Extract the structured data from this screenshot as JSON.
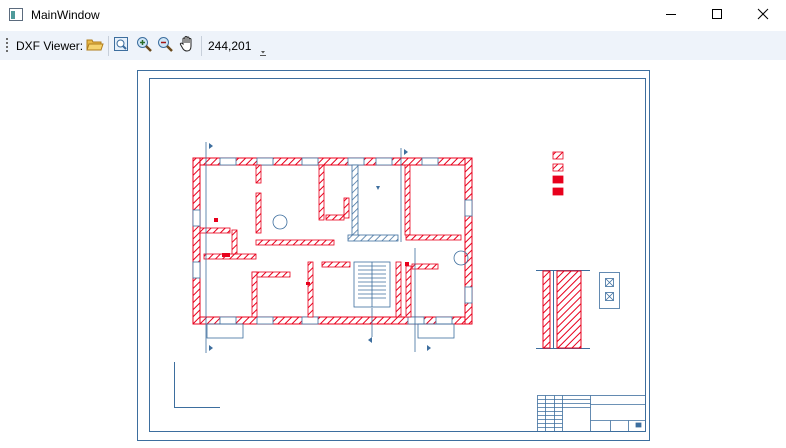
{
  "window": {
    "title": "MainWindow"
  },
  "toolbar": {
    "label": "DXF Viewer:",
    "coordinates": "244,201"
  },
  "icons": [
    "app-icon",
    "minimize-icon",
    "maximize-icon",
    "close-icon",
    "open-folder-icon",
    "zoom-fit-icon",
    "zoom-in-icon",
    "zoom-out-icon",
    "pan-hand-icon",
    "dropdown-arrow-icon"
  ],
  "colors": {
    "walls": "#e8001c",
    "lines": "#3d6e9e",
    "toolbar_bg": "#eef3fa"
  },
  "drawing": {
    "file_type": "DXF",
    "content": "architectural floor plan with title block"
  }
}
